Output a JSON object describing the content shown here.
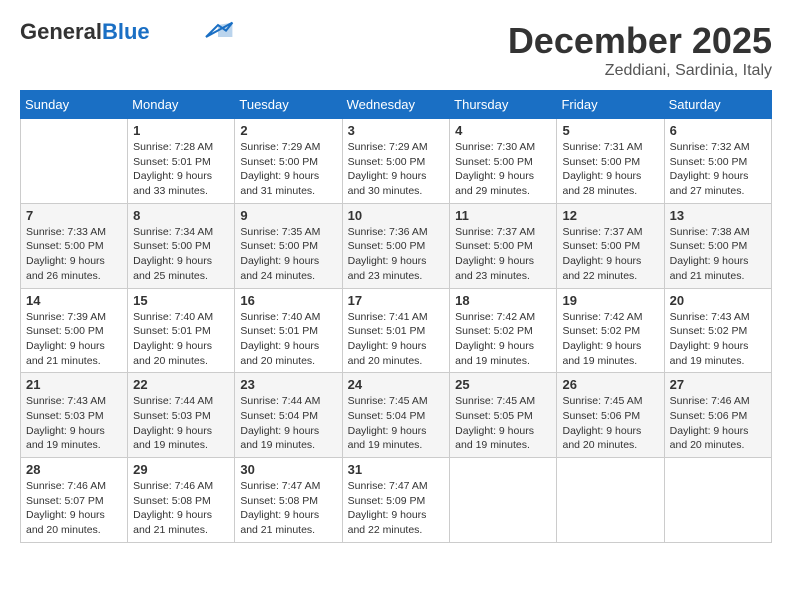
{
  "header": {
    "logo_line1": "General",
    "logo_line2": "Blue",
    "month_year": "December 2025",
    "location": "Zeddiani, Sardinia, Italy"
  },
  "weekdays": [
    "Sunday",
    "Monday",
    "Tuesday",
    "Wednesday",
    "Thursday",
    "Friday",
    "Saturday"
  ],
  "weeks": [
    [
      {
        "day": "",
        "sunrise": "",
        "sunset": "",
        "daylight": ""
      },
      {
        "day": "1",
        "sunrise": "Sunrise: 7:28 AM",
        "sunset": "Sunset: 5:01 PM",
        "daylight": "Daylight: 9 hours and 33 minutes."
      },
      {
        "day": "2",
        "sunrise": "Sunrise: 7:29 AM",
        "sunset": "Sunset: 5:00 PM",
        "daylight": "Daylight: 9 hours and 31 minutes."
      },
      {
        "day": "3",
        "sunrise": "Sunrise: 7:29 AM",
        "sunset": "Sunset: 5:00 PM",
        "daylight": "Daylight: 9 hours and 30 minutes."
      },
      {
        "day": "4",
        "sunrise": "Sunrise: 7:30 AM",
        "sunset": "Sunset: 5:00 PM",
        "daylight": "Daylight: 9 hours and 29 minutes."
      },
      {
        "day": "5",
        "sunrise": "Sunrise: 7:31 AM",
        "sunset": "Sunset: 5:00 PM",
        "daylight": "Daylight: 9 hours and 28 minutes."
      },
      {
        "day": "6",
        "sunrise": "Sunrise: 7:32 AM",
        "sunset": "Sunset: 5:00 PM",
        "daylight": "Daylight: 9 hours and 27 minutes."
      }
    ],
    [
      {
        "day": "7",
        "sunrise": "Sunrise: 7:33 AM",
        "sunset": "Sunset: 5:00 PM",
        "daylight": "Daylight: 9 hours and 26 minutes."
      },
      {
        "day": "8",
        "sunrise": "Sunrise: 7:34 AM",
        "sunset": "Sunset: 5:00 PM",
        "daylight": "Daylight: 9 hours and 25 minutes."
      },
      {
        "day": "9",
        "sunrise": "Sunrise: 7:35 AM",
        "sunset": "Sunset: 5:00 PM",
        "daylight": "Daylight: 9 hours and 24 minutes."
      },
      {
        "day": "10",
        "sunrise": "Sunrise: 7:36 AM",
        "sunset": "Sunset: 5:00 PM",
        "daylight": "Daylight: 9 hours and 23 minutes."
      },
      {
        "day": "11",
        "sunrise": "Sunrise: 7:37 AM",
        "sunset": "Sunset: 5:00 PM",
        "daylight": "Daylight: 9 hours and 23 minutes."
      },
      {
        "day": "12",
        "sunrise": "Sunrise: 7:37 AM",
        "sunset": "Sunset: 5:00 PM",
        "daylight": "Daylight: 9 hours and 22 minutes."
      },
      {
        "day": "13",
        "sunrise": "Sunrise: 7:38 AM",
        "sunset": "Sunset: 5:00 PM",
        "daylight": "Daylight: 9 hours and 21 minutes."
      }
    ],
    [
      {
        "day": "14",
        "sunrise": "Sunrise: 7:39 AM",
        "sunset": "Sunset: 5:00 PM",
        "daylight": "Daylight: 9 hours and 21 minutes."
      },
      {
        "day": "15",
        "sunrise": "Sunrise: 7:40 AM",
        "sunset": "Sunset: 5:01 PM",
        "daylight": "Daylight: 9 hours and 20 minutes."
      },
      {
        "day": "16",
        "sunrise": "Sunrise: 7:40 AM",
        "sunset": "Sunset: 5:01 PM",
        "daylight": "Daylight: 9 hours and 20 minutes."
      },
      {
        "day": "17",
        "sunrise": "Sunrise: 7:41 AM",
        "sunset": "Sunset: 5:01 PM",
        "daylight": "Daylight: 9 hours and 20 minutes."
      },
      {
        "day": "18",
        "sunrise": "Sunrise: 7:42 AM",
        "sunset": "Sunset: 5:02 PM",
        "daylight": "Daylight: 9 hours and 19 minutes."
      },
      {
        "day": "19",
        "sunrise": "Sunrise: 7:42 AM",
        "sunset": "Sunset: 5:02 PM",
        "daylight": "Daylight: 9 hours and 19 minutes."
      },
      {
        "day": "20",
        "sunrise": "Sunrise: 7:43 AM",
        "sunset": "Sunset: 5:02 PM",
        "daylight": "Daylight: 9 hours and 19 minutes."
      }
    ],
    [
      {
        "day": "21",
        "sunrise": "Sunrise: 7:43 AM",
        "sunset": "Sunset: 5:03 PM",
        "daylight": "Daylight: 9 hours and 19 minutes."
      },
      {
        "day": "22",
        "sunrise": "Sunrise: 7:44 AM",
        "sunset": "Sunset: 5:03 PM",
        "daylight": "Daylight: 9 hours and 19 minutes."
      },
      {
        "day": "23",
        "sunrise": "Sunrise: 7:44 AM",
        "sunset": "Sunset: 5:04 PM",
        "daylight": "Daylight: 9 hours and 19 minutes."
      },
      {
        "day": "24",
        "sunrise": "Sunrise: 7:45 AM",
        "sunset": "Sunset: 5:04 PM",
        "daylight": "Daylight: 9 hours and 19 minutes."
      },
      {
        "day": "25",
        "sunrise": "Sunrise: 7:45 AM",
        "sunset": "Sunset: 5:05 PM",
        "daylight": "Daylight: 9 hours and 19 minutes."
      },
      {
        "day": "26",
        "sunrise": "Sunrise: 7:45 AM",
        "sunset": "Sunset: 5:06 PM",
        "daylight": "Daylight: 9 hours and 20 minutes."
      },
      {
        "day": "27",
        "sunrise": "Sunrise: 7:46 AM",
        "sunset": "Sunset: 5:06 PM",
        "daylight": "Daylight: 9 hours and 20 minutes."
      }
    ],
    [
      {
        "day": "28",
        "sunrise": "Sunrise: 7:46 AM",
        "sunset": "Sunset: 5:07 PM",
        "daylight": "Daylight: 9 hours and 20 minutes."
      },
      {
        "day": "29",
        "sunrise": "Sunrise: 7:46 AM",
        "sunset": "Sunset: 5:08 PM",
        "daylight": "Daylight: 9 hours and 21 minutes."
      },
      {
        "day": "30",
        "sunrise": "Sunrise: 7:47 AM",
        "sunset": "Sunset: 5:08 PM",
        "daylight": "Daylight: 9 hours and 21 minutes."
      },
      {
        "day": "31",
        "sunrise": "Sunrise: 7:47 AM",
        "sunset": "Sunset: 5:09 PM",
        "daylight": "Daylight: 9 hours and 22 minutes."
      },
      {
        "day": "",
        "sunrise": "",
        "sunset": "",
        "daylight": ""
      },
      {
        "day": "",
        "sunrise": "",
        "sunset": "",
        "daylight": ""
      },
      {
        "day": "",
        "sunrise": "",
        "sunset": "",
        "daylight": ""
      }
    ]
  ]
}
